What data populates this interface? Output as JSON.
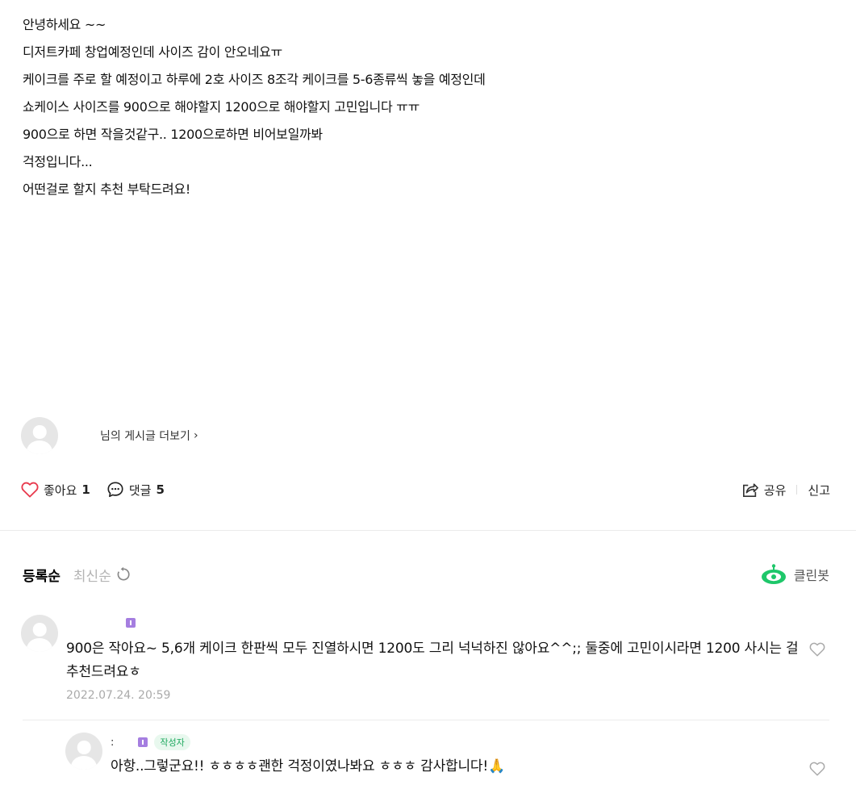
{
  "post": {
    "lines": [
      "안녕하세요 ~~",
      "디저트카페 창업예정인데 사이즈 감이 안오네요ㅠ",
      "케이크를  주로 할 예정이고 하루에 2호 사이즈 8조각 케이크를 5-6종류씩 놓을 예정인데",
      "쇼케이스 사이즈를 900으로 해야할지 1200으로 해야할지 고민입니다 ㅠㅠ",
      "900으로 하면 작을것같구.. 1200으로하면 비어보일까봐",
      "걱정입니다...",
      "어떤걸로 할지 추천 부탁드려요!"
    ]
  },
  "author": {
    "more_posts_label": "님의 게시글 더보기",
    "chevron": "›"
  },
  "actions": {
    "like_label": "좋아요",
    "like_count": "1",
    "comment_label": "댓글",
    "comment_count": "5",
    "share_label": "공유",
    "report_label": "신고"
  },
  "comments_header": {
    "sort_registered": "등록순",
    "sort_latest": "최신순",
    "cleanbot_label": "클린봇"
  },
  "comments": [
    {
      "text": "900은 작아요~ 5,6개 케이크 한판씩 모두 진열하시면 1200도 그리 넉넉하진 않아요^^;; 둘중에 고민이시라면 1200 사시는 걸 추천드려요ㅎ",
      "date": "2022.07.24. 20:59"
    },
    {
      "author_name": ":",
      "author_tag": "작성자",
      "text": "아항..그렇군요!! ㅎㅎㅎㅎ괜한 걱정이였나봐요 ㅎㅎㅎ 감사합니다!🙏"
    }
  ],
  "colors": {
    "like_heart": "#e8394d",
    "cleanbot_green": "#1ec76a",
    "level_badge": "#a57ee0"
  },
  "icons": [
    "heart-icon",
    "comment-bubble-icon",
    "share-icon",
    "refresh-icon",
    "cleanbot-icon",
    "chevron-right-icon"
  ]
}
